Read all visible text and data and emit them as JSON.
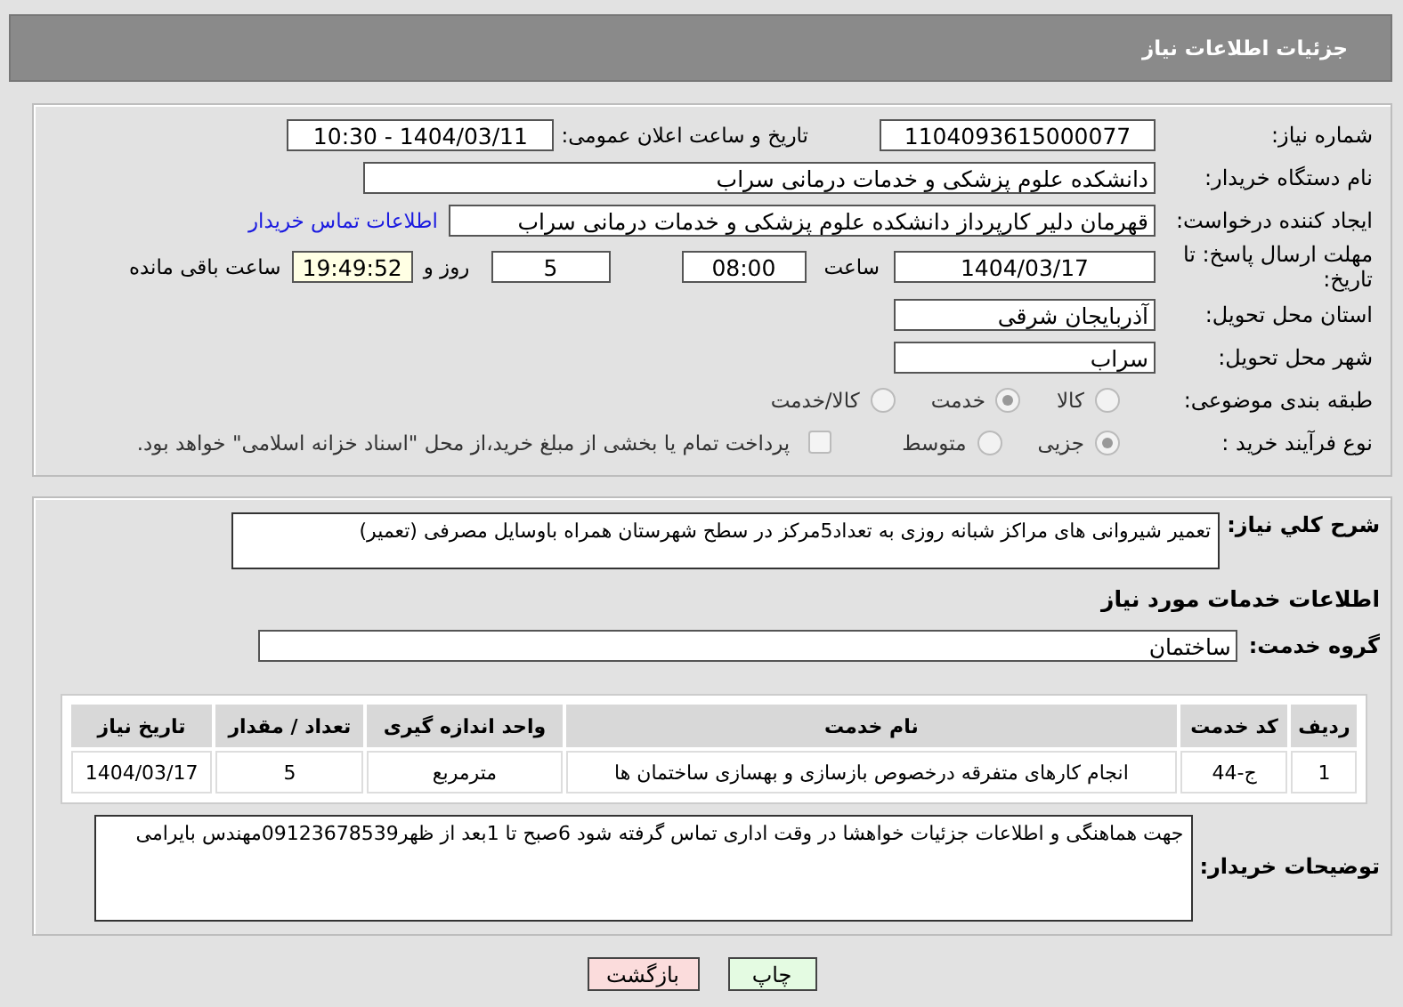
{
  "header": {
    "title": "جزئیات اطلاعات نیاز"
  },
  "need": {
    "number_label": "شماره نیاز:",
    "number": "1104093615000077",
    "announce_label": "تاریخ و ساعت اعلان عمومی:",
    "announce": "1404/03/11 - 10:30",
    "buyer_label": "نام دستگاه خریدار:",
    "buyer": "دانشکده علوم پزشکی و خدمات درمانی سراب",
    "creator_label": "ایجاد کننده درخواست:",
    "creator": "قهرمان دلیر کارپرداز دانشکده علوم پزشکی و خدمات درمانی سراب",
    "contact_link": "اطلاعات تماس خریدار",
    "deadline_label": "مهلت ارسال پاسخ: تا تاریخ:",
    "deadline_date": "1404/03/17",
    "time_label": "ساعت",
    "deadline_time": "08:00",
    "days": "5",
    "days_label": "روز و",
    "remaining": "19:49:52",
    "remaining_label": "ساعت باقی مانده",
    "province_label": "استان محل تحویل:",
    "province": "آذربایجان شرقی",
    "city_label": "شهر محل تحویل:",
    "city": "سراب",
    "category_label": "طبقه بندی موضوعی:",
    "categories": [
      {
        "label": "کالا",
        "selected": false
      },
      {
        "label": "خدمت",
        "selected": true
      },
      {
        "label": "کالا/خدمت",
        "selected": false
      }
    ],
    "process_label": "نوع فرآیند خرید :",
    "processes": [
      {
        "label": "جزیی",
        "selected": true
      },
      {
        "label": "متوسط",
        "selected": false
      }
    ],
    "payment": {
      "checked": false,
      "label": "پرداخت تمام یا بخشی از مبلغ خرید،از محل \"اسناد خزانه اسلامی\" خواهد بود."
    }
  },
  "details": {
    "summary_label": "شرح کلي نياز:",
    "summary": "تعمیر شیروانی های مراکز شبانه روزی به تعداد5مرکز در سطح شهرستان همراه باوسایل مصرفی (تعمیر)",
    "services_heading": "اطلاعات خدمات مورد نیاز",
    "group_label": "گروه خدمت:",
    "group": "ساختمان",
    "table": {
      "columns": [
        "ردیف",
        "کد خدمت",
        "نام خدمت",
        "واحد اندازه گیری",
        "تعداد / مقدار",
        "تاریخ نیاز"
      ],
      "rows": [
        [
          "1",
          "ج-44",
          "انجام کارهای متفرقه درخصوص بازسازی و بهسازی ساختمان ها",
          "مترمربع",
          "5",
          "1404/03/17"
        ]
      ]
    },
    "notes_label": "توضیحات خریدار:",
    "notes": "جهت هماهنگی و اطلاعات جزئیات خواهشا در وقت اداری تماس گرفته شود 6صبح تا 1بعد از ظهر09123678539مهندس بایرامی"
  },
  "buttons": [
    {
      "label": "چاپ",
      "kind": "print"
    },
    {
      "label": "بازگشت",
      "kind": "back"
    }
  ]
}
